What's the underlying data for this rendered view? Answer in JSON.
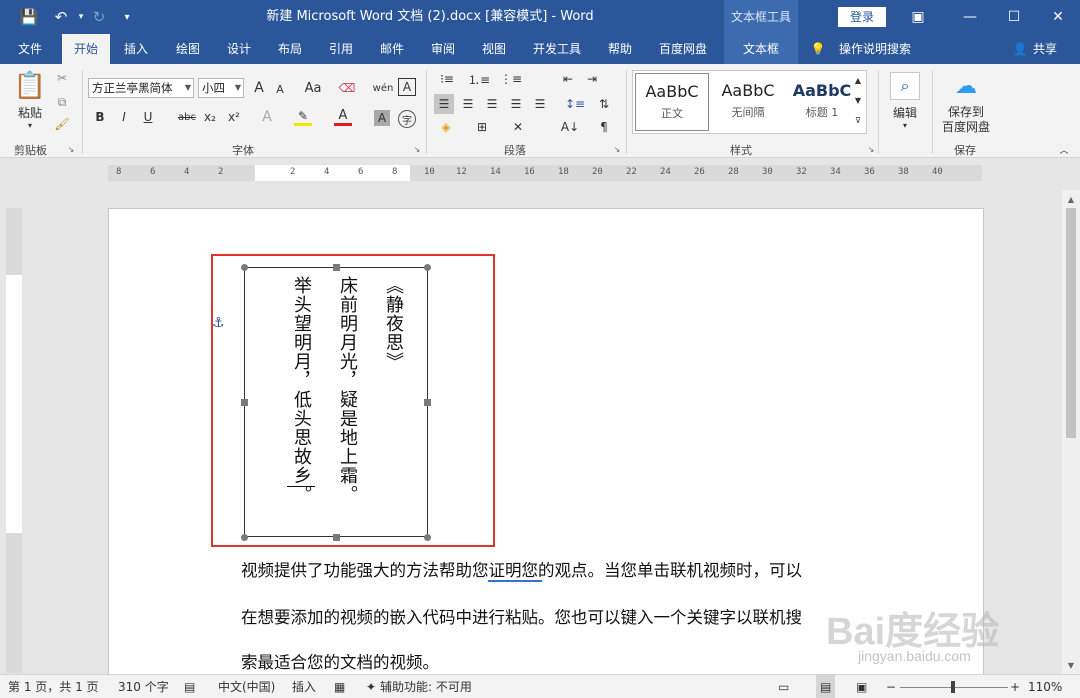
{
  "app": {
    "title": "新建 Microsoft Word 文档 (2).docx [兼容模式] - Word",
    "context_tools": "文本框工具",
    "login": "登录",
    "share": "共享"
  },
  "tabs": [
    "文件",
    "开始",
    "插入",
    "绘图",
    "设计",
    "布局",
    "引用",
    "邮件",
    "审阅",
    "视图",
    "开发工具",
    "帮助",
    "百度网盘",
    "文本框"
  ],
  "tell_me": "操作说明搜索",
  "ribbon": {
    "clipboard": {
      "paste": "粘贴",
      "label": "剪贴板"
    },
    "font": {
      "family": "方正兰亭黑简体",
      "size": "小四",
      "label": "字体",
      "bold": "B",
      "italic": "I",
      "underline": "U",
      "strike": "abc",
      "subscript": "x₂",
      "superscript": "x²",
      "grow": "A",
      "shrink": "A",
      "case": "Aa",
      "phonetic": "wén",
      "border_char": "A",
      "enclose": "字"
    },
    "paragraph": {
      "label": "段落"
    },
    "styles": {
      "label": "样式",
      "items": [
        {
          "preview": "AaBbC",
          "name": "正文"
        },
        {
          "preview": "AaBbC",
          "name": "无间隔"
        },
        {
          "preview": "AaBbC",
          "name": "标题 1"
        }
      ]
    },
    "editing": {
      "label": "编辑"
    },
    "save": {
      "label": "保存到百度网盘",
      "line1": "保存到",
      "line2": "百度网盘",
      "group": "保存"
    }
  },
  "ruler": {
    "ticks": [
      "8",
      "6",
      "4",
      "2",
      "2",
      "4",
      "6",
      "8",
      "10",
      "12",
      "14",
      "16",
      "18",
      "20",
      "22",
      "24",
      "26",
      "28",
      "30",
      "32",
      "34",
      "36",
      "38",
      "40"
    ]
  },
  "document": {
    "poem": {
      "title": "《静夜思》",
      "line1": "床前明月光，疑是地上霜。",
      "line2": "举头望明月，低头思故乡。"
    },
    "paragraph_lines": [
      "视频提供了功能强大的方法帮助您证明您的观点。当您单击联机视频时，可以",
      "在想要添加的视频的嵌入代码中进行粘贴。您也可以键入一个关键字以联机搜",
      "索最适合您的文档的视频。"
    ]
  },
  "status": {
    "page": "第 1 页，共 1 页",
    "words": "310 个字",
    "language": "中文(中国)",
    "insert": "插入",
    "accessibility": "辅助功能: 不可用",
    "zoom": "110%"
  },
  "watermark": {
    "main": "Bai度经验",
    "sub": "jingyan.baidu.com"
  },
  "colors": {
    "brand": "#2b579a",
    "highlight_box": "#e0332d",
    "ribbon": "#f3f3f3"
  }
}
